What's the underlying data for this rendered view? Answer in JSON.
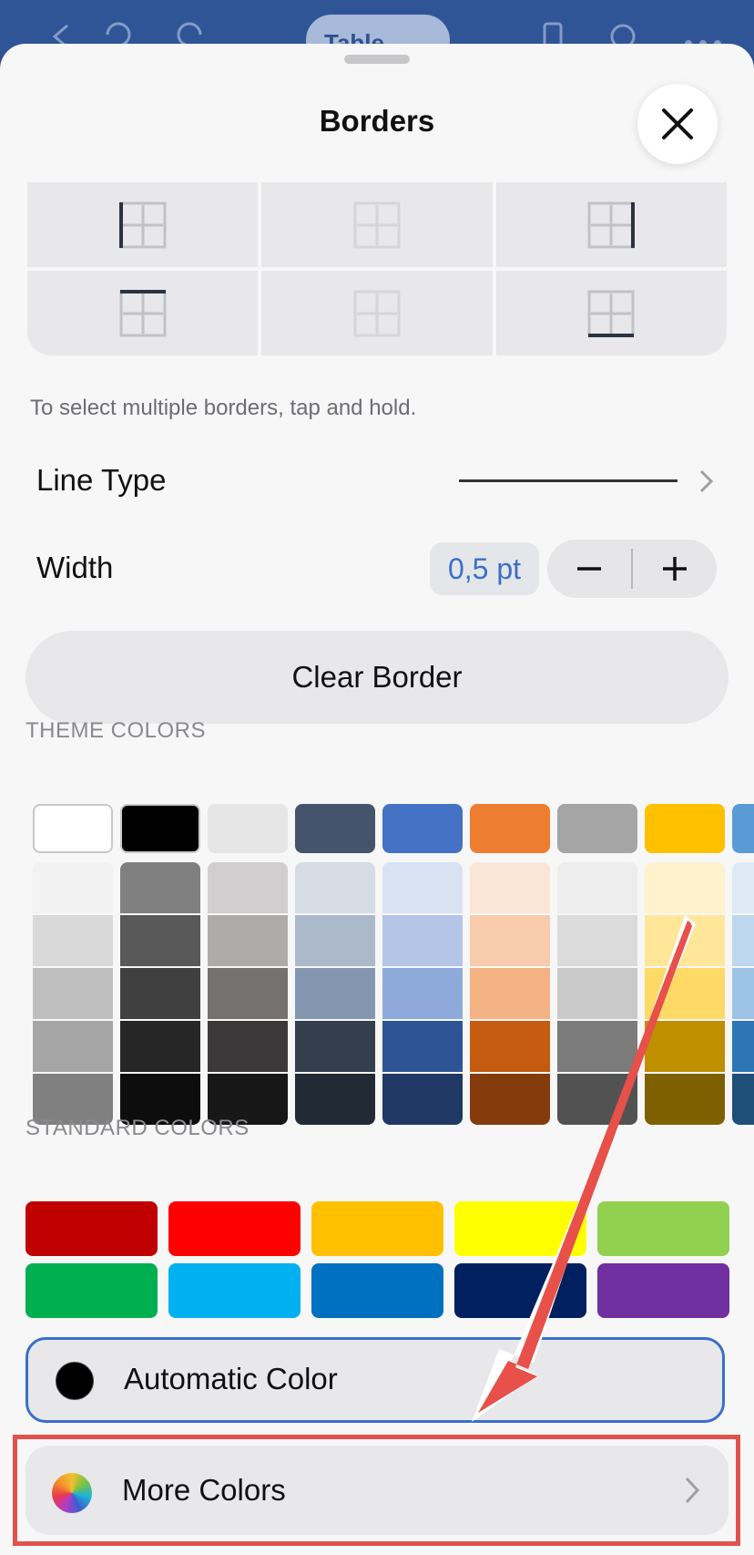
{
  "toolbar": {
    "context_tab": "Table"
  },
  "sheet": {
    "title": "Borders",
    "hint": "To select multiple borders, tap and hold.",
    "line_type_label": "Line Type",
    "width_label": "Width",
    "width_value": "0,5 pt",
    "clear_border_label": "Clear Border",
    "theme_colors_label": "THEME COLORS",
    "standard_colors_label": "STANDARD COLORS",
    "automatic_color_label": "Automatic Color",
    "more_colors_label": "More Colors"
  },
  "border_options": [
    "left-border-icon",
    "inside-vertical-border-icon",
    "right-border-icon",
    "top-border-icon",
    "inside-horizontal-border-icon",
    "bottom-border-icon"
  ],
  "theme_colors_top": [
    "#ffffff",
    "#000000",
    "#e7e6e6",
    "#44546a",
    "#4472c4",
    "#ed7d31",
    "#a5a5a5",
    "#ffc000",
    "#5b9bd5"
  ],
  "theme_shades": [
    [
      "#f2f2f2",
      "#d9d9d9",
      "#bfbfbf",
      "#a6a6a6",
      "#808080"
    ],
    [
      "#808080",
      "#595959",
      "#404040",
      "#262626",
      "#0d0d0d"
    ],
    [
      "#d0cece",
      "#aeabab",
      "#757171",
      "#3a3838",
      "#181717"
    ],
    [
      "#d6dce4",
      "#acb9ca",
      "#8497b0",
      "#333f4f",
      "#222a35"
    ],
    [
      "#d9e2f3",
      "#b4c6e7",
      "#8eaadb",
      "#2f5496",
      "#1f3864"
    ],
    [
      "#fbe5d6",
      "#f8cbad",
      "#f4b183",
      "#c55a11",
      "#843c0c"
    ],
    [
      "#ededed",
      "#dbdbdb",
      "#c9c9c9",
      "#7b7b7b",
      "#525252"
    ],
    [
      "#fff2cc",
      "#ffe699",
      "#ffd966",
      "#bf8f00",
      "#7f6000"
    ],
    [
      "#deebf7",
      "#bdd7ee",
      "#9dc3e6",
      "#2e75b6",
      "#1f4e79"
    ]
  ],
  "standard_colors": [
    "#c00000",
    "#ff0000",
    "#ffc000",
    "#ffff00",
    "#92d050",
    "#00b050",
    "#00b0f0",
    "#0070c0",
    "#002060",
    "#7030a0"
  ],
  "accent_color": "#3a6fc8",
  "annotation_color": "#e0524d"
}
